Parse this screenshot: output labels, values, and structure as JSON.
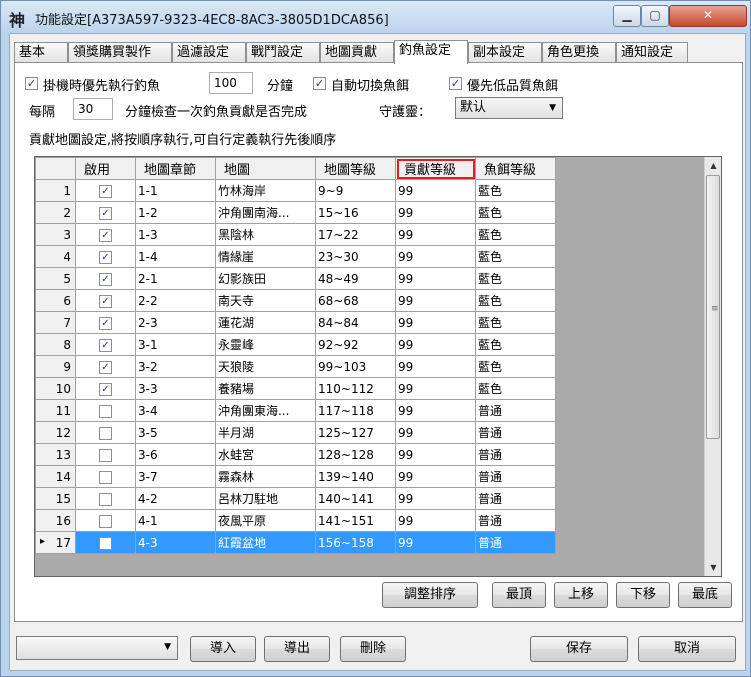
{
  "window": {
    "title": "功能設定[A373A597-9323-4EC8-8AC3-3805D1DCA856]",
    "app_icon_glyph": "神",
    "controls": {
      "minimize": "▁",
      "maximize": "▢",
      "close": "✕"
    }
  },
  "tabs": [
    {
      "label": "基本",
      "active": false
    },
    {
      "label": "領獎購買製作",
      "active": false
    },
    {
      "label": "過濾設定",
      "active": false
    },
    {
      "label": "戰鬥設定",
      "active": false
    },
    {
      "label": "地圖貢獻",
      "active": false
    },
    {
      "label": "釣魚設定",
      "active": true
    },
    {
      "label": "副本設定",
      "active": false
    },
    {
      "label": "角色更換",
      "active": false
    },
    {
      "label": "通知設定",
      "active": false
    }
  ],
  "fishing": {
    "hang_priority": {
      "label": "掛機時優先執行釣魚",
      "checked": true
    },
    "minutes_value": "100",
    "minutes_label": "分鐘",
    "auto_switch_bait": {
      "label": "自動切換魚餌",
      "checked": true
    },
    "prefer_low_bait": {
      "label": "優先低品質魚餌",
      "checked": true
    },
    "every_label": "每隔",
    "interval_value": "30",
    "interval_label": "分鐘檢查一次釣魚貢獻是否完成",
    "guardian_label": "守護靈：",
    "guardian_value": "默认",
    "group_label": "貢獻地圖設定,將按順序執行,可自行定義執行先後順序"
  },
  "grid": {
    "headers": [
      "啟用",
      "地圖章節",
      "地圖",
      "地圖等級",
      "貢獻等級",
      "魚餌等級"
    ],
    "rows": [
      {
        "n": "1",
        "enabled": true,
        "chapter": "1-1",
        "map": "竹林海岸",
        "level": "9~9",
        "contrib": "99",
        "bait": "藍色"
      },
      {
        "n": "2",
        "enabled": true,
        "chapter": "1-2",
        "map": "沖角團南海...",
        "level": "15~16",
        "contrib": "99",
        "bait": "藍色"
      },
      {
        "n": "3",
        "enabled": true,
        "chapter": "1-3",
        "map": "黑陰林",
        "level": "17~22",
        "contrib": "99",
        "bait": "藍色"
      },
      {
        "n": "4",
        "enabled": true,
        "chapter": "1-4",
        "map": "情緣崖",
        "level": "23~30",
        "contrib": "99",
        "bait": "藍色"
      },
      {
        "n": "5",
        "enabled": true,
        "chapter": "2-1",
        "map": "幻影族田",
        "level": "48~49",
        "contrib": "99",
        "bait": "藍色"
      },
      {
        "n": "6",
        "enabled": true,
        "chapter": "2-2",
        "map": "南天寺",
        "level": "68~68",
        "contrib": "99",
        "bait": "藍色"
      },
      {
        "n": "7",
        "enabled": true,
        "chapter": "2-3",
        "map": "蓮花湖",
        "level": "84~84",
        "contrib": "99",
        "bait": "藍色"
      },
      {
        "n": "8",
        "enabled": true,
        "chapter": "3-1",
        "map": "永靈峰",
        "level": "92~92",
        "contrib": "99",
        "bait": "藍色"
      },
      {
        "n": "9",
        "enabled": true,
        "chapter": "3-2",
        "map": "天狼陵",
        "level": "99~103",
        "contrib": "99",
        "bait": "藍色"
      },
      {
        "n": "10",
        "enabled": true,
        "chapter": "3-3",
        "map": "養豬場",
        "level": "110~112",
        "contrib": "99",
        "bait": "藍色"
      },
      {
        "n": "11",
        "enabled": false,
        "chapter": "3-4",
        "map": "沖角團東海...",
        "level": "117~118",
        "contrib": "99",
        "bait": "普通"
      },
      {
        "n": "12",
        "enabled": false,
        "chapter": "3-5",
        "map": "半月湖",
        "level": "125~127",
        "contrib": "99",
        "bait": "普通"
      },
      {
        "n": "13",
        "enabled": false,
        "chapter": "3-6",
        "map": "水蛙宮",
        "level": "128~128",
        "contrib": "99",
        "bait": "普通"
      },
      {
        "n": "14",
        "enabled": false,
        "chapter": "3-7",
        "map": "霧森林",
        "level": "139~140",
        "contrib": "99",
        "bait": "普通"
      },
      {
        "n": "15",
        "enabled": false,
        "chapter": "4-2",
        "map": "呂林刀駐地",
        "level": "140~141",
        "contrib": "99",
        "bait": "普通"
      },
      {
        "n": "16",
        "enabled": false,
        "chapter": "4-1",
        "map": "夜風平原",
        "level": "141~151",
        "contrib": "99",
        "bait": "普通"
      },
      {
        "n": "17",
        "enabled": false,
        "chapter": "4-3",
        "map": "紅霞盆地",
        "level": "156~158",
        "contrib": "99",
        "bait": "普通",
        "selected": true
      }
    ]
  },
  "order_buttons": {
    "adjust": "調整排序",
    "top": "最頂",
    "up": "上移",
    "down": "下移",
    "bottom": "最底"
  },
  "footer": {
    "preset_value": "",
    "import": "導入",
    "export": "導出",
    "delete": "刪除",
    "save": "保存",
    "cancel": "取消"
  },
  "colors": {
    "selection": "#3399ff",
    "highlight_box": "#e02020",
    "title_bg": "#bcd3ec"
  }
}
